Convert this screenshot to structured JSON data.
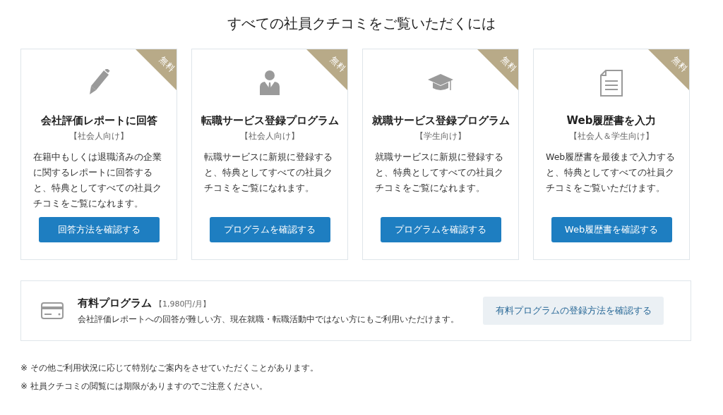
{
  "heading": "すべての社員クチコミをご覧いただくには",
  "cards": [
    {
      "badge": "無料",
      "title": "会社評価レポートに回答",
      "audience": "【社会人向け】",
      "description": "在籍中もしくは退職済みの企業に関するレポートに回答すると、特典としてすべての社員クチコミをご覧になれます。",
      "button": "回答方法を確認する"
    },
    {
      "badge": "無料",
      "title": "転職サービス登録プログラム",
      "audience": "【社会人向け】",
      "description": "転職サービスに新規に登録すると、特典としてすべての社員クチコミをご覧になれます。",
      "button": "プログラムを確認する"
    },
    {
      "badge": "無料",
      "title": "就職サービス登録プログラム",
      "audience": "【学生向け】",
      "description": "就職サービスに新規に登録すると、特典としてすべての社員クチコミをご覧になれます。",
      "button": "プログラムを確認する"
    },
    {
      "badge": "無料",
      "title": "Web履歴書を入力",
      "audience": "【社会人＆学生向け】",
      "description": "Web履歴書を最後まで入力すると、特典としてすべての社員クチコミをご覧いただけます。",
      "button": "Web履歴書を確認する"
    }
  ],
  "paid": {
    "title": "有料プログラム",
    "price": "【1,980円/月】",
    "description": "会社評価レポートへの回答が難しい方、現在就職・転職活動中ではない方にもご利用いただけます。",
    "button": "有料プログラムの登録方法を確認する"
  },
  "notes": [
    "※ その他ご利用状況に応じて特別なご案内をさせていただくことがあります。",
    "※ 社員クチコミの閲覧には期限がありますのでご注意ください。"
  ]
}
